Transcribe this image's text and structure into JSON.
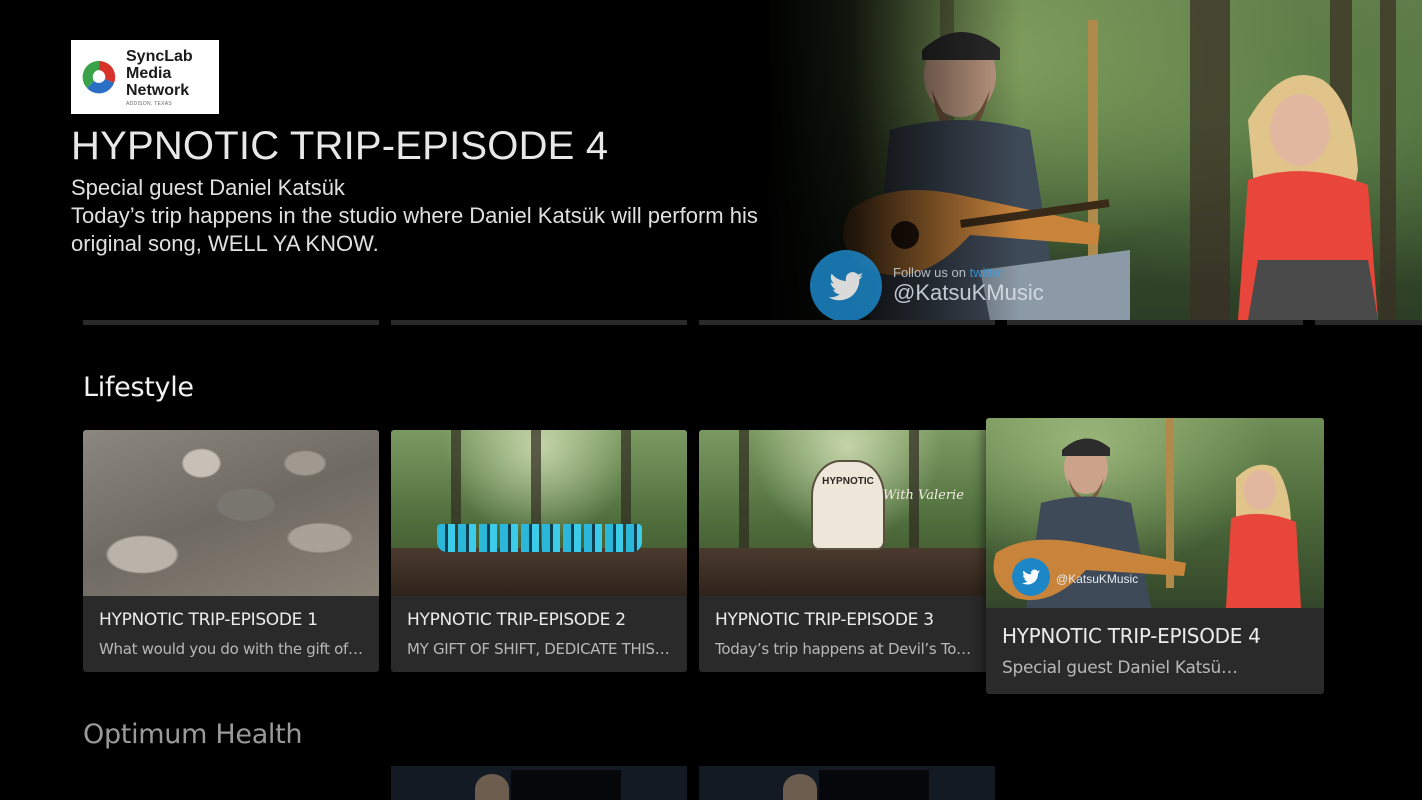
{
  "brand": {
    "logo_line1": "SyncLab",
    "logo_line2": "Media",
    "logo_line3": "Network",
    "logo_sub": "ADDISON, TEXAS"
  },
  "hero": {
    "title": "HYPNOTIC TRIP-EPISODE 4",
    "desc_line1": "Special guest Daniel Katsük",
    "desc_line2": "Today’s trip happens in the studio where Daniel Katsük will perform his",
    "desc_line3": "original song, WELL YA KNOW.",
    "follow_text": "Follow us on",
    "follow_network": "twitter",
    "twitter_handle": "@KatsuKMusic"
  },
  "rows": [
    {
      "title": "Lifestyle",
      "cards": [
        {
          "title": "HYPNOTIC TRIP-EPISODE 1",
          "desc": "What would you do with the gift of …"
        },
        {
          "title": "HYPNOTIC TRIP-EPISODE 2",
          "desc": "MY GIFT OF SHIFT, DEDICATE THIS …"
        },
        {
          "title": "HYPNOTIC TRIP-EPISODE 3",
          "desc": "Today’s trip happens at Devil’s Tow…",
          "badge": "HYPNOTIC",
          "overlay": "With Valerie"
        },
        {
          "title": "HYPNOTIC TRIP-EPISODE 4",
          "desc": "Special guest Daniel Katsük…",
          "handle": "@KatsuKMusic",
          "focused": true
        }
      ]
    },
    {
      "title": "Optimum Health"
    }
  ],
  "colors": {
    "background": "#000000",
    "card": "#2a2a2a",
    "twitter": "#1c86c7"
  }
}
